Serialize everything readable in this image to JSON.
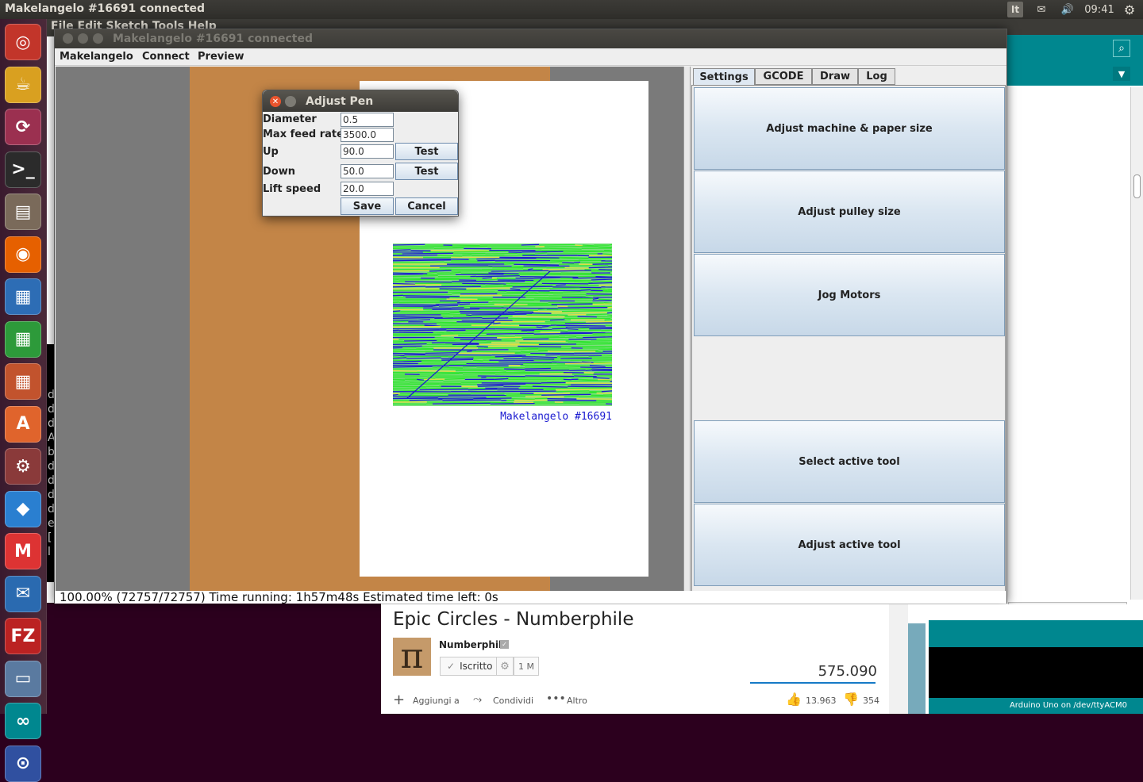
{
  "topbar": {
    "title": "Makelangelo #16691 connected",
    "keyboard": "It",
    "time": "09:41"
  },
  "launcher": [
    {
      "name": "ubuntu-dash-icon",
      "glyph": "◎",
      "color": "#c2352a"
    },
    {
      "name": "teapot-app-icon",
      "glyph": "☕",
      "color": "#d9a020"
    },
    {
      "name": "sync-app-icon",
      "glyph": "⟳",
      "color": "#9b3050"
    },
    {
      "name": "terminal-icon",
      "glyph": ">_",
      "color": "#2b2b2b"
    },
    {
      "name": "files-icon",
      "glyph": "▤",
      "color": "#7a6a5a"
    },
    {
      "name": "firefox-icon",
      "glyph": "◉",
      "color": "#e66000"
    },
    {
      "name": "writer-icon",
      "glyph": "▦",
      "color": "#2d6db5"
    },
    {
      "name": "calc-icon",
      "glyph": "▦",
      "color": "#2d9a3a"
    },
    {
      "name": "impress-icon",
      "glyph": "▦",
      "color": "#c2532d"
    },
    {
      "name": "software-center-icon",
      "glyph": "A",
      "color": "#e0642c"
    },
    {
      "name": "settings-icon",
      "glyph": "⚙",
      "color": "#8a3a3a"
    },
    {
      "name": "dropbox-icon",
      "glyph": "◆",
      "color": "#2a7fd0"
    },
    {
      "name": "gmail-icon",
      "glyph": "M",
      "color": "#d33"
    },
    {
      "name": "thunderbird-icon",
      "glyph": "✉",
      "color": "#2a6ab0"
    },
    {
      "name": "filezilla-icon",
      "glyph": "FZ",
      "color": "#b22"
    },
    {
      "name": "remmina-icon",
      "glyph": "▭",
      "color": "#5a7aa0"
    },
    {
      "name": "arduino-launch-icon",
      "glyph": "∞",
      "color": "#00878f"
    },
    {
      "name": "remote-icon",
      "glyph": "⊙",
      "color": "#3050a0"
    }
  ],
  "bgmenu": "File  Edit  Sketch  Tools  Help",
  "window": {
    "title": "Makelangelo #16691 connected"
  },
  "menu": [
    "Makelangelo",
    "Connect",
    "Preview"
  ],
  "canvas": {
    "signature": "Makelangelo #16691",
    "colors": {
      "green": "#2ee52e",
      "blue": "#1a1ad0",
      "yellow": "#e0e040"
    }
  },
  "status": "100.00% (72757/72757) Time running: 1h57m48s Estimated time left: 0s",
  "tabs": [
    "Settings",
    "GCODE",
    "Draw",
    "Log"
  ],
  "buttons": [
    "Adjust machine & paper size",
    "Adjust pulley size",
    "Jog Motors",
    "Select active tool",
    "Adjust active tool"
  ],
  "dialog": {
    "title": "Adjust Pen",
    "labels": [
      "Diameter",
      "Max feed rate",
      "Up",
      "Down",
      "Lift speed"
    ],
    "values": [
      "0.5",
      "3500.0",
      "90.0",
      "50.0",
      "20.0"
    ],
    "test": "Test",
    "save": "Save",
    "cancel": "Cancel"
  },
  "youtube": {
    "title": "Epic Circles - Numberphile",
    "channel": "Numberphile",
    "subscribed": "Iscritto",
    "subs": "1 M",
    "views": "575.090",
    "add": "Aggiungi a",
    "share": "Condividi",
    "more": "Altro",
    "likes": "13.963",
    "dislikes": "354"
  },
  "arduino": {
    "status": "Arduino Uno on /dev/ttyACM0"
  },
  "terminal": {
    "lines": [
      "d",
      "d",
      "d",
      "A",
      "b",
      "d",
      "d",
      "d",
      "d",
      "e",
      "[",
      "l"
    ]
  }
}
